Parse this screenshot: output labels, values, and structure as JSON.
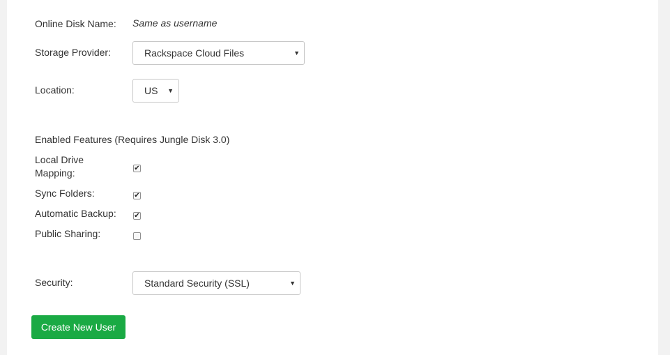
{
  "form": {
    "disk_name_label": "Online Disk Name:",
    "disk_name_value": "Same as username",
    "storage_provider_label": "Storage Provider:",
    "storage_provider_value": "Rackspace Cloud Files",
    "location_label": "Location:",
    "location_value": "US",
    "enabled_features_heading": "Enabled Features (Requires Jungle Disk 3.0)",
    "features": [
      {
        "label_line1": "Local Drive",
        "label_line2": "Mapping:",
        "checked": true
      },
      {
        "label": "Sync Folders:",
        "checked": true
      },
      {
        "label": "Automatic Backup:",
        "checked": true
      },
      {
        "label": "Public Sharing:",
        "checked": false
      }
    ],
    "security_label": "Security:",
    "security_value": "Standard Security (SSL)",
    "create_button": "Create New User"
  },
  "colors": {
    "button_green": "#1aaa44",
    "page_background": "#f2f2f2",
    "panel_background": "#ffffff"
  },
  "icons": {
    "dropdown": "triangle-down-icon",
    "check": "checkmark-icon"
  }
}
